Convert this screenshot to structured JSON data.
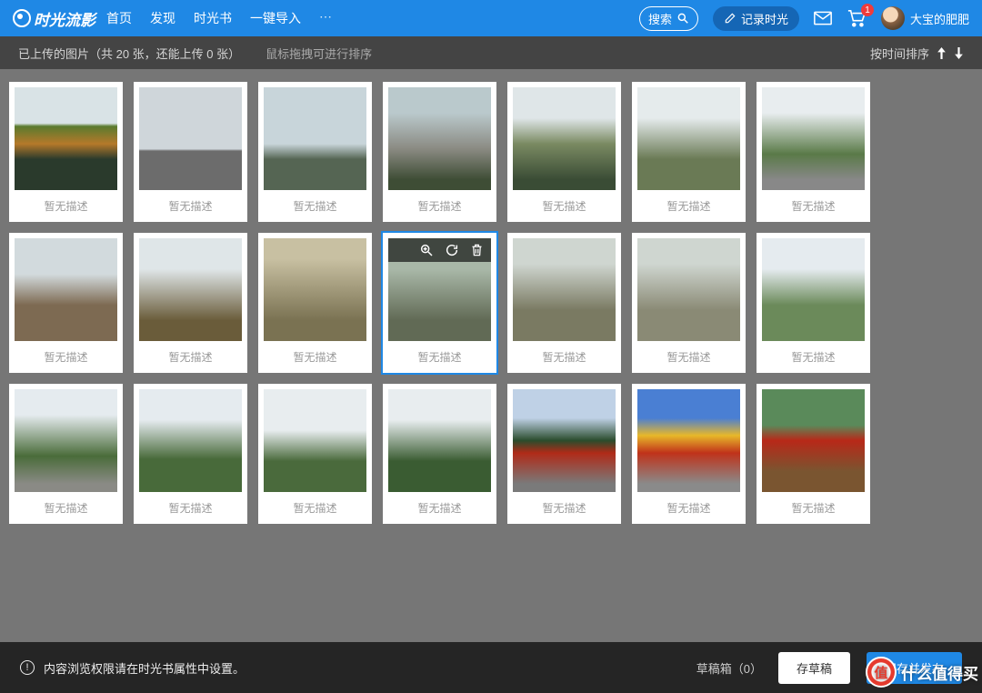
{
  "header": {
    "logo_text": "时光流影",
    "nav": [
      "首页",
      "发现",
      "时光书",
      "一键导入"
    ],
    "search_label": "搜索",
    "record_label": "记录时光",
    "cart_badge": "1",
    "username": "大宝的肥肥"
  },
  "subbar": {
    "uploaded_info": "已上传的图片（共 20 张，还能上传 0 张）",
    "drag_hint": "鼠标拖拽可进行排序",
    "sort_label": "按时间排序"
  },
  "card_caption": "暂无描述",
  "bottom": {
    "notice": "内容浏览权限请在时光书属性中设置。",
    "draft_box": "草稿箱（0）",
    "save_draft": "存草稿",
    "publish": "保存并发布"
  },
  "watermark": "什么值得买",
  "wm_char": "值"
}
